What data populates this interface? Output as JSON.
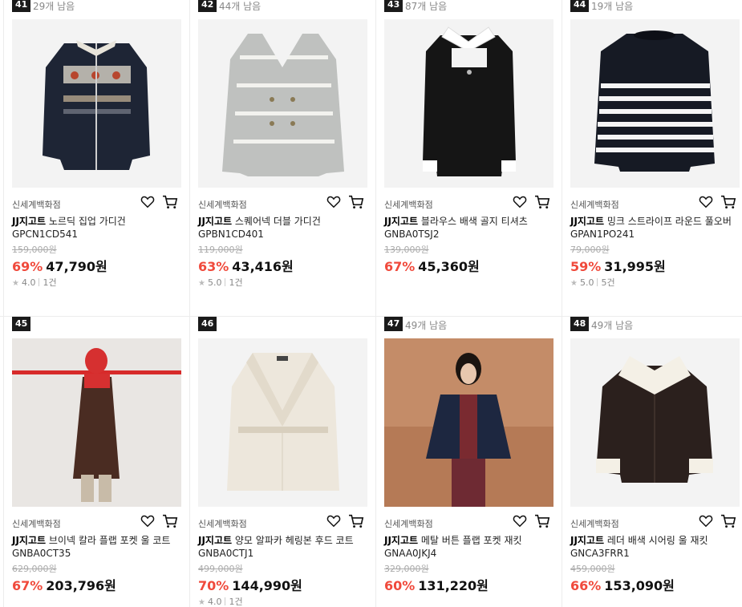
{
  "colors": {
    "discount": "#f04a3c",
    "rank_badge": "#1a1a1a"
  },
  "products": [
    {
      "rank": "41",
      "stock": "29개 남음",
      "seller": "신세계백화점",
      "brand": "JJ지고트",
      "name": "노르딕 집업 가디건 GPCN1CD541",
      "original_price": "159,000원",
      "discount": "69%",
      "price": "47,790원",
      "rating": "4.0",
      "reviews": "1건",
      "image": "navy-nordic-cardigan"
    },
    {
      "rank": "42",
      "stock": "44개 남음",
      "seller": "신세계백화점",
      "brand": "JJ지고트",
      "name": "스퀘어넥 더블 가디건 GPBN1CD401",
      "original_price": "119,000원",
      "discount": "63%",
      "price": "43,416원",
      "rating": "5.0",
      "reviews": "1건",
      "image": "grey-stripe-cardigan"
    },
    {
      "rank": "43",
      "stock": "87개 남음",
      "seller": "신세계백화점",
      "brand": "JJ지고트",
      "name": "블라우스 배색 골지 티셔츠 GNBA0TSJ2",
      "original_price": "139,000원",
      "discount": "67%",
      "price": "45,360원",
      "rating": "",
      "reviews": "",
      "image": "black-collar-top"
    },
    {
      "rank": "44",
      "stock": "19개 남음",
      "seller": "신세계백화점",
      "brand": "JJ지고트",
      "name": "밍크 스트라이프 라운드 풀오버 GPAN1PO241",
      "original_price": "79,000원",
      "discount": "59%",
      "price": "31,995원",
      "rating": "5.0",
      "reviews": "5건",
      "image": "stripe-pullover"
    },
    {
      "rank": "45",
      "stock": "",
      "seller": "신세계백화점",
      "brand": "JJ지고트",
      "name": "브이넥 칼라 플랩 포켓 울 코트 GNBA0CT35",
      "original_price": "629,000원",
      "discount": "67%",
      "price": "203,796원",
      "rating": "",
      "reviews": "",
      "image": "brown-wool-coat"
    },
    {
      "rank": "46",
      "stock": "",
      "seller": "신세계백화점",
      "brand": "JJ지고트",
      "name": "양모 알파카 헤링본 후드 코트 GNBA0CTJ1",
      "original_price": "499,000원",
      "discount": "70%",
      "price": "144,990원",
      "rating": "4.0",
      "reviews": "1건",
      "image": "ivory-hood-coat"
    },
    {
      "rank": "47",
      "stock": "49개 남음",
      "seller": "신세계백화점",
      "brand": "JJ지고트",
      "name": "메탈 버튼 플랩 포켓 재킷 GNAA0JKJ4",
      "original_price": "329,000원",
      "discount": "60%",
      "price": "131,220원",
      "rating": "",
      "reviews": "",
      "image": "navy-jacket-model"
    },
    {
      "rank": "48",
      "stock": "49개 남음",
      "seller": "신세계백화점",
      "brand": "JJ지고트",
      "name": "레더 배색 시어링 울 재킷 GNCA3FRR1",
      "original_price": "459,000원",
      "discount": "66%",
      "price": "153,090원",
      "rating": "",
      "reviews": "",
      "image": "shearling-jacket"
    }
  ]
}
